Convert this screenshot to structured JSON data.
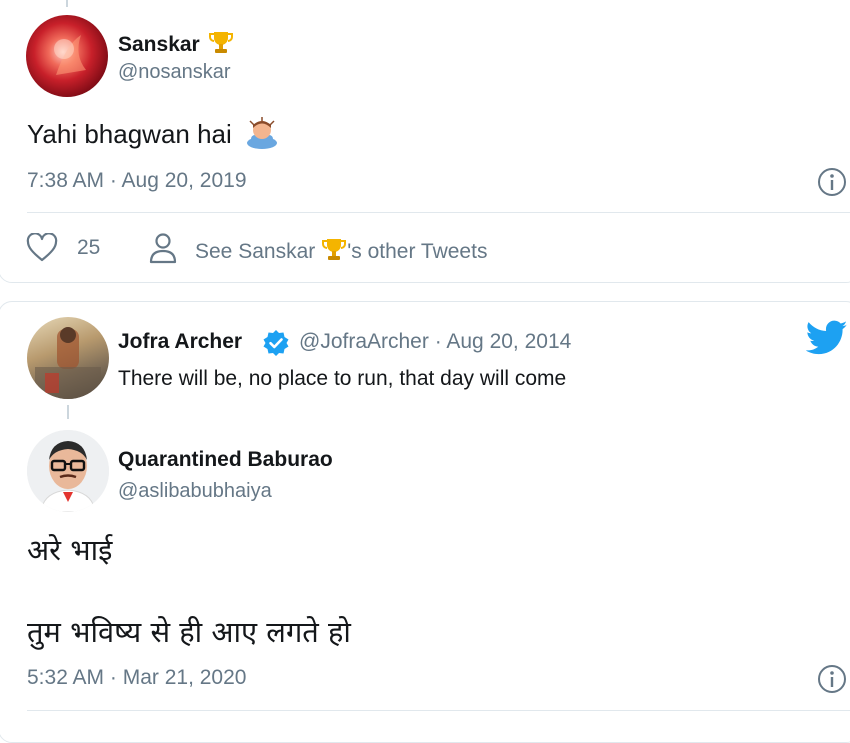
{
  "tweet1": {
    "name": "Sanskar",
    "handle": "@nosanskar",
    "text": "Yahi bhagwan hai",
    "timestamp": "7:38 AM · Aug 20, 2019",
    "likes": "25",
    "see_other_prefix": "See Sanskar",
    "see_other_suffix": "'s other Tweets"
  },
  "quoted": {
    "name": "Jofra Archer",
    "handle": "@JofraArcher",
    "date": "· Aug 20, 2014",
    "text": "There will be, no place to run, that day will come"
  },
  "tweet2": {
    "name": "Quarantined Baburao",
    "handle": "@aslibabubhaiya",
    "line1": "अरे भाई",
    "line2": "तुम भविष्य से ही आए लगते हो",
    "timestamp": "5:32 AM · Mar 21, 2020"
  },
  "colors": {
    "twitter_blue": "#1da1f2",
    "muted": "#657786",
    "border": "#e1e8ed",
    "verified": "#1da1f2"
  },
  "icons": [
    "trophy-icon",
    "man-bowing-emoji",
    "info-icon",
    "heart-icon",
    "person-icon",
    "verified-badge-icon",
    "twitter-bird-icon"
  ]
}
